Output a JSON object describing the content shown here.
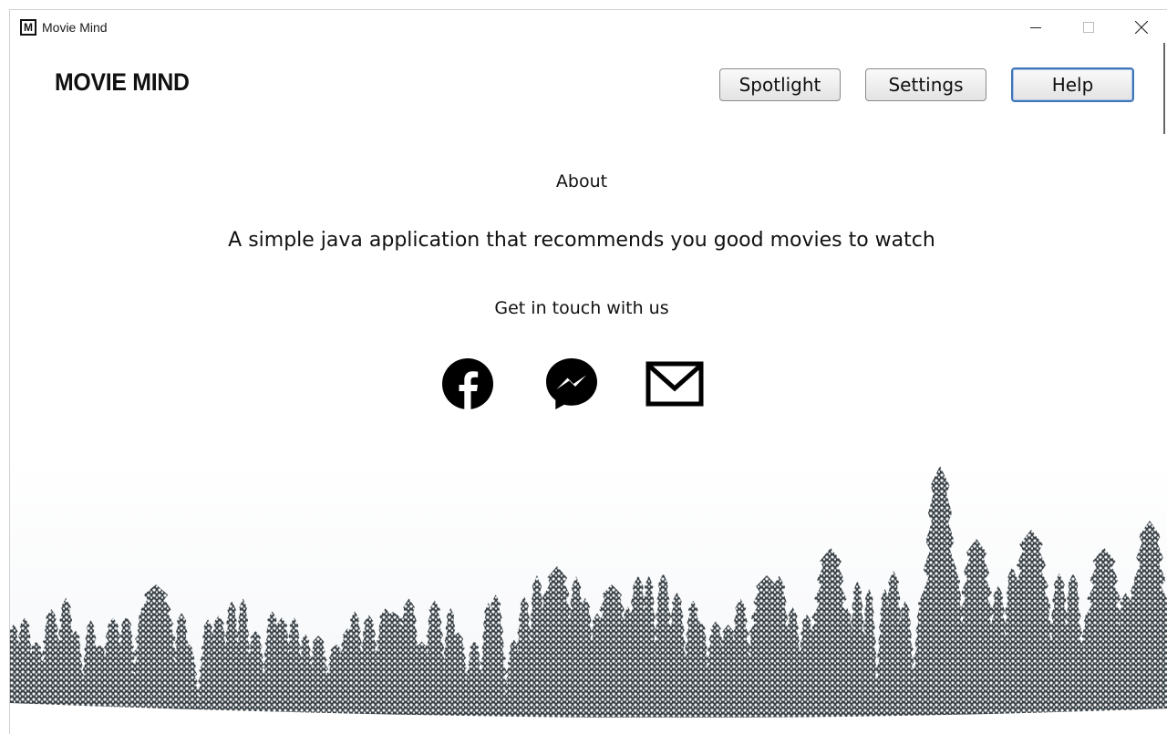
{
  "window": {
    "title": "Movie Mind",
    "app_icon_letter": "M",
    "controls": [
      "minimize-icon",
      "maximize-icon",
      "close-icon"
    ]
  },
  "header": {
    "brand": "MOVIE MIND",
    "nav": {
      "spotlight_label": "Spotlight",
      "settings_label": "Settings",
      "help_label": "Help"
    },
    "active_nav": "Help"
  },
  "main": {
    "about_title": "About",
    "tagline": "A simple java application that recommends you good movies to watch",
    "contact_heading": "Get in touch with us",
    "social_links": [
      "facebook-icon",
      "messenger-icon",
      "mail-icon"
    ]
  },
  "colors": {
    "accent_border": "#3f74b8",
    "text": "#111111"
  }
}
